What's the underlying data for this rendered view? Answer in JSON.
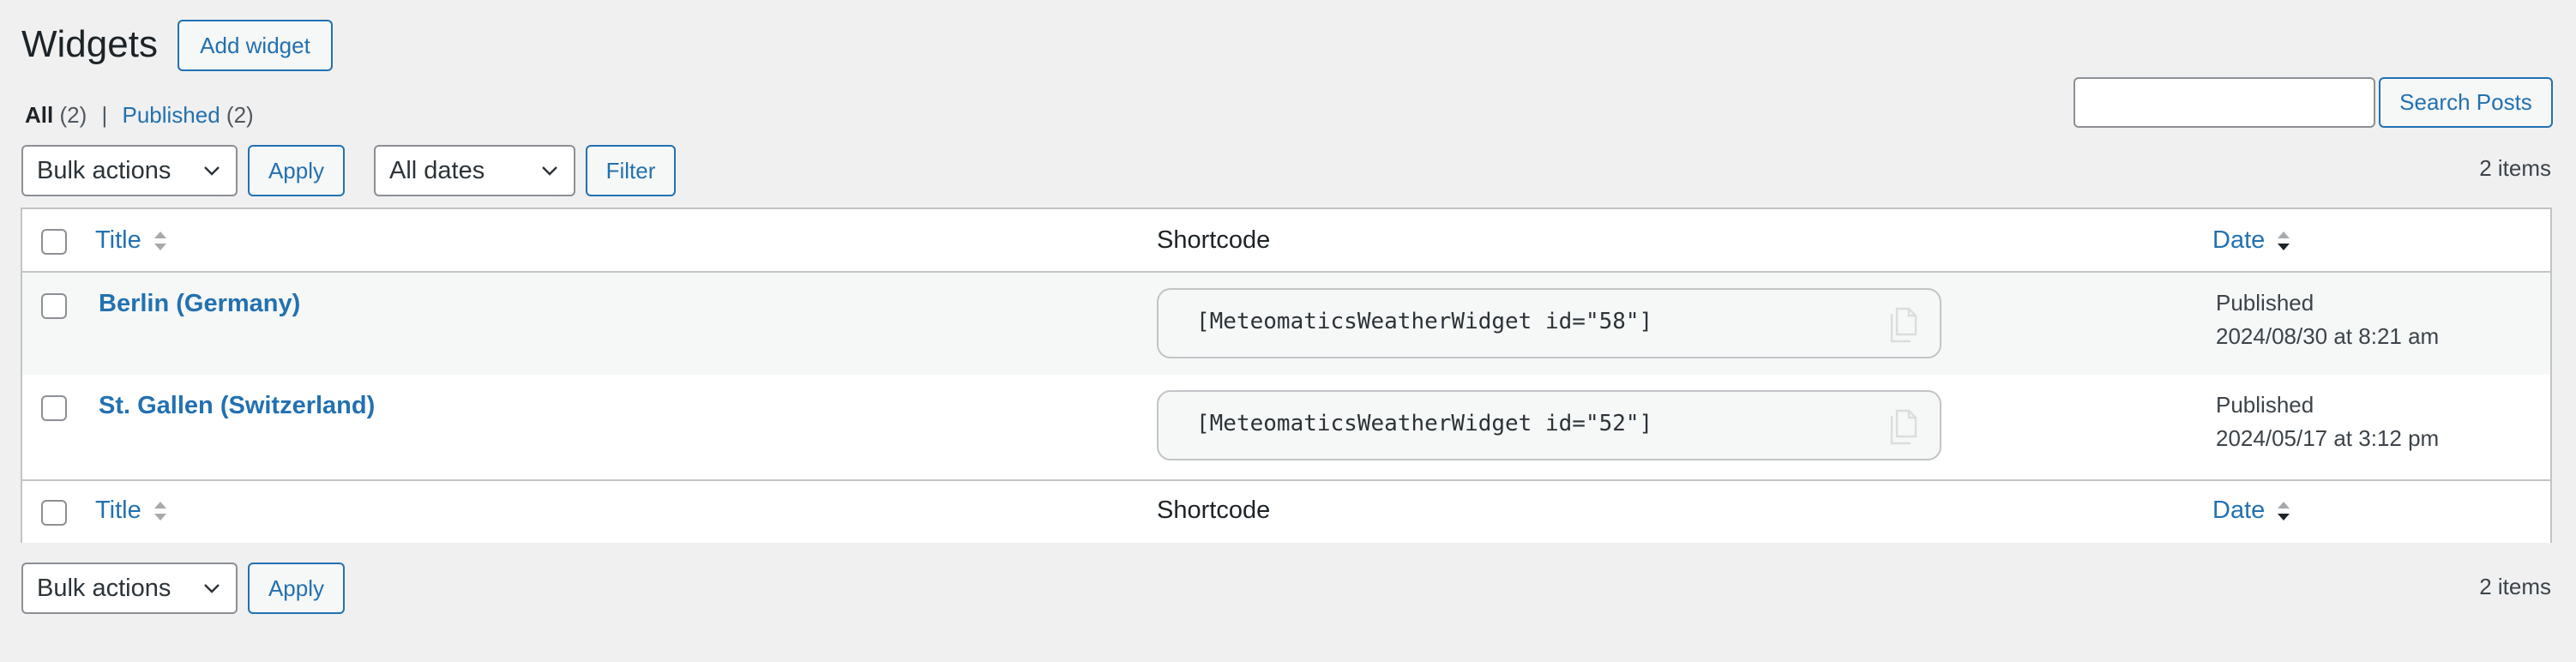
{
  "header": {
    "title": "Widgets",
    "add_button": "Add widget"
  },
  "views": {
    "all_label": "All",
    "all_count": "(2)",
    "separator": "|",
    "published_label": "Published",
    "published_count": "(2)"
  },
  "search": {
    "value": "",
    "button": "Search Posts"
  },
  "tablenav_top": {
    "bulk_actions": "Bulk actions",
    "apply": "Apply",
    "dates": "All dates",
    "filter": "Filter",
    "items_count": "2 items"
  },
  "table": {
    "columns": {
      "title": "Title",
      "shortcode": "Shortcode",
      "date": "Date"
    },
    "rows": [
      {
        "title": "Berlin (Germany)",
        "shortcode": "[MeteomaticsWeatherWidget id=\"58\"]",
        "status": "Published",
        "date": "2024/08/30 at 8:21 am"
      },
      {
        "title": "St. Gallen (Switzerland)",
        "shortcode": "[MeteomaticsWeatherWidget id=\"52\"]",
        "status": "Published",
        "date": "2024/05/17 at 3:12 pm"
      }
    ]
  },
  "tablenav_bottom": {
    "bulk_actions": "Bulk actions",
    "apply": "Apply",
    "items_count": "2 items"
  },
  "colors": {
    "link": "#2271b1",
    "background": "#f0f0f1",
    "border": "#c3c4c7"
  },
  "icons": {
    "sort": "sort-arrows-icon",
    "copy": "copy-icon",
    "dropdown": "chevron-down-icon"
  }
}
